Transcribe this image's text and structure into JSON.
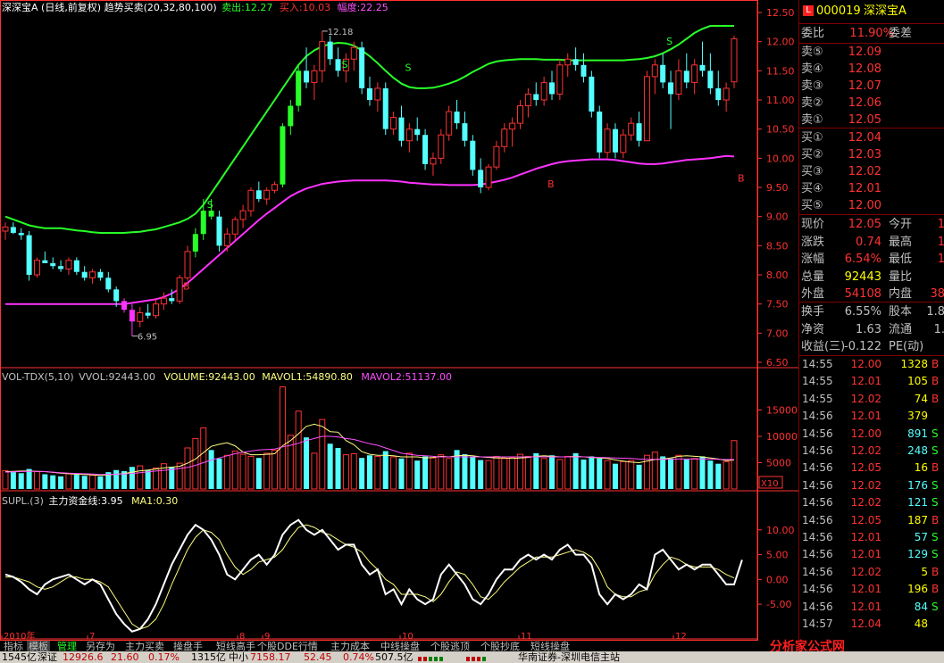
{
  "header": {
    "title": "深深宝A (日线,前复权) 趋势买卖(20,32,80,100)",
    "sell_label": "卖出:12.27",
    "buy_label": "买入:10.03",
    "amp_label": "幅度:22.25"
  },
  "vol_header": {
    "name": "VOL-TDX(5,10)",
    "vvol": "VVOL:92443.00",
    "volume": "VOLUME:92443.00",
    "mavol1": "MAVOL1:54890.80",
    "mavol2": "MAVOL2:51137.00"
  },
  "supl_header": {
    "name": "SUPL.(3)",
    "line": "主力资金线:3.95",
    "ma": "MA1:0.30"
  },
  "annotations": {
    "high": "12.18",
    "low": "6.95",
    "s": "S",
    "b": "B",
    "x10": "X10"
  },
  "axis": {
    "price_ticks": [
      "12.50",
      "12.00",
      "11.50",
      "11.00",
      "10.50",
      "10.00",
      "9.50",
      "9.00",
      "8.50",
      "8.00",
      "7.50",
      "7.00",
      "6.50"
    ],
    "vol_ticks": [
      "15000",
      "10000",
      "5000"
    ],
    "supl_ticks": [
      "10.00",
      "5.00",
      "0.00",
      "-5.00"
    ],
    "months": [
      "2010年",
      "7",
      "8",
      "9",
      "10",
      "11",
      "12"
    ]
  },
  "quote": {
    "code": "000019",
    "name": "深深宝A",
    "weibi_label": "委比",
    "weibi_value": "11.90%",
    "weicha_label": "委差",
    "sell": [
      {
        "label": "卖⑤",
        "price": "12.09"
      },
      {
        "label": "卖④",
        "price": "12.08"
      },
      {
        "label": "卖③",
        "price": "12.07"
      },
      {
        "label": "卖②",
        "price": "12.06"
      },
      {
        "label": "卖①",
        "price": "12.05"
      }
    ],
    "buy": [
      {
        "label": "买①",
        "price": "12.04"
      },
      {
        "label": "买②",
        "price": "12.03"
      },
      {
        "label": "买③",
        "price": "12.02"
      },
      {
        "label": "买④",
        "price": "12.01"
      },
      {
        "label": "买⑤",
        "price": "12.00"
      }
    ],
    "stats": [
      {
        "l1": "现价",
        "v1": "12.05",
        "l2": "今开",
        "v2": "1"
      },
      {
        "l1": "涨跌",
        "v1": "0.74",
        "l2": "最高",
        "v2": "1"
      },
      {
        "l1": "涨幅",
        "v1": "6.54%",
        "l2": "最低",
        "v2": "1"
      },
      {
        "l1": "总量",
        "v1": "92443",
        "l2": "量比",
        "v2": ""
      },
      {
        "l1": "外盘",
        "v1": "54108",
        "l2": "内盘",
        "v2": "38"
      }
    ],
    "stats2": [
      {
        "l1": "换手",
        "v1": "6.55%",
        "l2": "股本",
        "v2": "1.8"
      },
      {
        "l1": "净资",
        "v1": "1.63",
        "l2": "流通",
        "v2": "1."
      },
      {
        "l1": "收益(三)",
        "v1": "-0.122",
        "l2": "PE(动)",
        "v2": ""
      }
    ],
    "ticks": [
      {
        "t": "14:55",
        "p": "12.00",
        "v": "1328",
        "f": "B"
      },
      {
        "t": "14:55",
        "p": "12.01",
        "v": "105",
        "f": "B"
      },
      {
        "t": "14:55",
        "p": "12.02",
        "v": "74",
        "f": "B"
      },
      {
        "t": "14:56",
        "p": "12.01",
        "v": "379",
        "f": ""
      },
      {
        "t": "14:56",
        "p": "12.00",
        "v": "891",
        "f": "S"
      },
      {
        "t": "14:56",
        "p": "12.02",
        "v": "248",
        "f": "S"
      },
      {
        "t": "14:56",
        "p": "12.05",
        "v": "16",
        "f": "B"
      },
      {
        "t": "14:56",
        "p": "12.02",
        "v": "176",
        "f": "S"
      },
      {
        "t": "14:56",
        "p": "12.02",
        "v": "121",
        "f": "S"
      },
      {
        "t": "14:56",
        "p": "12.05",
        "v": "187",
        "f": "B"
      },
      {
        "t": "14:56",
        "p": "12.01",
        "v": "57",
        "f": "S"
      },
      {
        "t": "14:56",
        "p": "12.01",
        "v": "129",
        "v2": "",
        "f": "S"
      },
      {
        "t": "14:56",
        "p": "12.02",
        "v": "5",
        "f": "B"
      },
      {
        "t": "14:56",
        "p": "12.01",
        "v": "196",
        "f": "B"
      },
      {
        "t": "14:56",
        "p": "12.01",
        "v": "84",
        "f": "S"
      },
      {
        "t": "14:57",
        "p": "12.04",
        "v": "48",
        "f": ""
      }
    ]
  },
  "tabs": [
    "指标",
    "模板",
    "管理",
    "另存为",
    "主力买卖",
    "操盘手",
    "短线高手",
    "个股DDE行情",
    "主力成本",
    "中线操盘",
    "个股逃顶",
    "个股抄底",
    "短线操盘"
  ],
  "status": {
    "s1": "1545亿",
    "s2_label": "深证",
    "s2_val": "12926.6",
    "s2_chg": "21.60",
    "s2_pct": "0.17%",
    "s3": "1315亿",
    "s4_label": "中小",
    "s4_val": "7158.17",
    "s4_chg": "52.45",
    "s4_pct": "0.74%",
    "s5": "507.5亿",
    "broker": "华南证券-深圳电信主站"
  },
  "logo_text": "分析家公式网",
  "colors": {
    "up": "#ff3232",
    "down": "#54ffff",
    "upper_band": "#28ff28",
    "lower_band": "#ff32ff",
    "mavol1": "#ffff80",
    "mavol2": "#ff50ff",
    "supl": "#ffffff",
    "supl_ma": "#ffff80",
    "axis": "#ff3232",
    "bg": "#000000"
  },
  "chart_data": {
    "type": "candlestick",
    "price_range": [
      6.5,
      12.5
    ],
    "ohlc": [
      [
        8.75,
        8.9,
        8.6,
        8.82
      ],
      [
        8.82,
        8.9,
        8.7,
        8.72
      ],
      [
        8.72,
        8.8,
        8.6,
        8.68
      ],
      [
        8.68,
        8.75,
        7.9,
        8.0
      ],
      [
        8.0,
        8.3,
        7.95,
        8.25
      ],
      [
        8.25,
        8.4,
        8.2,
        8.2
      ],
      [
        8.2,
        8.3,
        8.1,
        8.15
      ],
      [
        8.15,
        8.25,
        8.05,
        8.1
      ],
      [
        8.1,
        8.3,
        8.0,
        8.25
      ],
      [
        8.25,
        8.3,
        8.0,
        8.05
      ],
      [
        8.05,
        8.15,
        7.9,
        7.95
      ],
      [
        7.95,
        8.1,
        7.85,
        8.05
      ],
      [
        8.05,
        8.1,
        7.9,
        7.95
      ],
      [
        7.95,
        8.05,
        7.7,
        7.75
      ],
      [
        7.75,
        7.8,
        7.45,
        7.55
      ],
      [
        7.55,
        7.6,
        7.35,
        7.4
      ],
      [
        7.4,
        7.5,
        6.95,
        7.2
      ],
      [
        7.2,
        7.45,
        7.1,
        7.35
      ],
      [
        7.35,
        7.5,
        7.25,
        7.3
      ],
      [
        7.3,
        7.6,
        7.25,
        7.5
      ],
      [
        7.5,
        7.7,
        7.4,
        7.6
      ],
      [
        7.6,
        7.75,
        7.5,
        7.55
      ],
      [
        7.55,
        8.0,
        7.5,
        7.95
      ],
      [
        7.95,
        8.5,
        7.9,
        8.4
      ],
      [
        8.4,
        8.8,
        8.3,
        8.7
      ],
      [
        8.7,
        9.3,
        8.6,
        9.1
      ],
      [
        9.1,
        9.3,
        8.95,
        9.0
      ],
      [
        9.0,
        9.1,
        8.4,
        8.5
      ],
      [
        8.5,
        8.8,
        8.4,
        8.7
      ],
      [
        8.7,
        9.0,
        8.6,
        8.95
      ],
      [
        8.95,
        9.2,
        8.8,
        9.1
      ],
      [
        9.1,
        9.5,
        9.0,
        9.45
      ],
      [
        9.45,
        9.6,
        9.25,
        9.3
      ],
      [
        9.3,
        9.5,
        9.2,
        9.45
      ],
      [
        9.45,
        9.6,
        9.4,
        9.55
      ],
      [
        9.55,
        10.6,
        9.5,
        10.55
      ],
      [
        10.55,
        11.0,
        10.4,
        10.9
      ],
      [
        10.9,
        11.6,
        10.8,
        11.5
      ],
      [
        11.5,
        11.9,
        11.2,
        11.3
      ],
      [
        11.3,
        11.6,
        11.0,
        11.5
      ],
      [
        11.5,
        12.18,
        11.3,
        12.0
      ],
      [
        12.0,
        12.1,
        11.6,
        11.7
      ],
      [
        11.7,
        11.9,
        11.4,
        11.5
      ],
      [
        11.5,
        11.8,
        11.3,
        11.7
      ],
      [
        11.7,
        12.0,
        11.5,
        11.9
      ],
      [
        11.9,
        12.0,
        11.1,
        11.2
      ],
      [
        11.2,
        11.4,
        10.9,
        11.0
      ],
      [
        11.0,
        11.3,
        10.8,
        11.2
      ],
      [
        11.2,
        11.3,
        10.4,
        10.5
      ],
      [
        10.5,
        10.8,
        10.4,
        10.7
      ],
      [
        10.7,
        10.9,
        10.2,
        10.3
      ],
      [
        10.3,
        10.6,
        10.1,
        10.5
      ],
      [
        10.5,
        10.7,
        10.3,
        10.4
      ],
      [
        10.4,
        10.5,
        9.8,
        9.9
      ],
      [
        9.9,
        10.1,
        9.7,
        10.0
      ],
      [
        10.0,
        10.5,
        9.9,
        10.4
      ],
      [
        10.4,
        10.9,
        10.3,
        10.8
      ],
      [
        10.8,
        11.0,
        10.5,
        10.6
      ],
      [
        10.6,
        10.8,
        10.2,
        10.3
      ],
      [
        10.3,
        10.4,
        9.7,
        9.8
      ],
      [
        9.8,
        10.0,
        9.4,
        9.5
      ],
      [
        9.5,
        9.9,
        9.45,
        9.85
      ],
      [
        9.85,
        10.3,
        9.8,
        10.2
      ],
      [
        10.2,
        10.6,
        10.1,
        10.5
      ],
      [
        10.5,
        10.7,
        10.2,
        10.6
      ],
      [
        10.6,
        11.0,
        10.5,
        10.9
      ],
      [
        10.9,
        11.2,
        10.7,
        11.1
      ],
      [
        11.1,
        11.3,
        10.9,
        11.0
      ],
      [
        11.0,
        11.4,
        10.9,
        11.3
      ],
      [
        11.3,
        11.5,
        11.0,
        11.1
      ],
      [
        11.1,
        11.7,
        11.0,
        11.6
      ],
      [
        11.6,
        11.8,
        11.4,
        11.7
      ],
      [
        11.7,
        11.9,
        11.5,
        11.6
      ],
      [
        11.6,
        11.8,
        11.3,
        11.4
      ],
      [
        11.4,
        11.5,
        10.7,
        10.8
      ],
      [
        10.8,
        10.9,
        10.0,
        10.1
      ],
      [
        10.1,
        10.6,
        10.0,
        10.5
      ],
      [
        10.5,
        10.6,
        10.0,
        10.1
      ],
      [
        10.1,
        10.5,
        10.0,
        10.4
      ],
      [
        10.4,
        10.7,
        10.3,
        10.6
      ],
      [
        10.6,
        10.8,
        10.2,
        10.3
      ],
      [
        10.3,
        11.5,
        10.3,
        11.4
      ],
      [
        11.4,
        11.7,
        11.1,
        11.6
      ],
      [
        11.6,
        11.8,
        11.2,
        11.3
      ],
      [
        11.3,
        11.5,
        10.5,
        11.1
      ],
      [
        11.1,
        11.7,
        11.0,
        11.5
      ],
      [
        11.5,
        11.8,
        11.2,
        11.3
      ],
      [
        11.3,
        11.7,
        11.1,
        11.6
      ],
      [
        11.6,
        12.0,
        11.4,
        11.5
      ],
      [
        11.5,
        11.8,
        11.1,
        11.2
      ],
      [
        11.2,
        11.5,
        10.9,
        11.0
      ],
      [
        11.0,
        11.3,
        10.8,
        11.2
      ],
      [
        11.31,
        12.1,
        11.2,
        12.05
      ]
    ],
    "upper_band": [
      9.0,
      8.95,
      8.9,
      8.85,
      8.82,
      8.8,
      8.8,
      8.8,
      8.78,
      8.76,
      8.75,
      8.73,
      8.72,
      8.72,
      8.72,
      8.72,
      8.73,
      8.74,
      8.76,
      8.78,
      8.82,
      8.86,
      8.9,
      8.96,
      9.05,
      9.2,
      9.4,
      9.6,
      9.8,
      10.0,
      10.2,
      10.4,
      10.6,
      10.8,
      11.0,
      11.2,
      11.4,
      11.6,
      11.75,
      11.85,
      11.92,
      11.96,
      11.98,
      11.97,
      11.93,
      11.85,
      11.75,
      11.63,
      11.5,
      11.38,
      11.28,
      11.22,
      11.2,
      11.2,
      11.21,
      11.24,
      11.28,
      11.33,
      11.4,
      11.48,
      11.55,
      11.62,
      11.66,
      11.68,
      11.69,
      11.7,
      11.7,
      11.7,
      11.69,
      11.69,
      11.69,
      11.68,
      11.68,
      11.68,
      11.68,
      11.68,
      11.68,
      11.68,
      11.68,
      11.69,
      11.7,
      11.72,
      11.75,
      11.8,
      11.87,
      11.95,
      12.05,
      12.15,
      12.22,
      12.27,
      12.27,
      12.27,
      12.27
    ],
    "lower_band": [
      7.5,
      7.5,
      7.5,
      7.5,
      7.5,
      7.5,
      7.5,
      7.5,
      7.5,
      7.5,
      7.5,
      7.5,
      7.5,
      7.5,
      7.5,
      7.5,
      7.52,
      7.54,
      7.56,
      7.58,
      7.62,
      7.68,
      7.76,
      7.86,
      7.98,
      8.1,
      8.22,
      8.34,
      8.46,
      8.58,
      8.7,
      8.82,
      8.94,
      9.05,
      9.15,
      9.25,
      9.35,
      9.42,
      9.48,
      9.52,
      9.56,
      9.58,
      9.6,
      9.61,
      9.62,
      9.62,
      9.62,
      9.62,
      9.62,
      9.61,
      9.6,
      9.58,
      9.57,
      9.56,
      9.55,
      9.55,
      9.54,
      9.54,
      9.54,
      9.54,
      9.55,
      9.57,
      9.6,
      9.63,
      9.67,
      9.72,
      9.77,
      9.82,
      9.86,
      9.9,
      9.93,
      9.95,
      9.96,
      9.97,
      9.98,
      9.98,
      9.98,
      9.97,
      9.95,
      9.93,
      9.91,
      9.9,
      9.9,
      9.91,
      9.93,
      9.95,
      9.97,
      9.98,
      9.99,
      10.0,
      10.02,
      10.04,
      10.03
    ],
    "volume": [
      3500,
      3200,
      3000,
      3800,
      3300,
      2800,
      2600,
      2400,
      2900,
      2700,
      2500,
      2600,
      2400,
      3200,
      3600,
      3400,
      4200,
      4400,
      3600,
      4000,
      4800,
      4200,
      4900,
      7800,
      9600,
      11600,
      7400,
      5800,
      6400,
      7200,
      6600,
      6200,
      5900,
      6800,
      7400,
      19400,
      10200,
      14800,
      9800,
      6800,
      13200,
      8600,
      7800,
      6500,
      6700,
      5900,
      6400,
      6200,
      7200,
      6100,
      5800,
      6800,
      5400,
      6200,
      5900,
      6500,
      5800,
      7400,
      6600,
      6200,
      5500,
      5400,
      6200,
      5800,
      6000,
      6600,
      6200,
      6800,
      5800,
      6400,
      5600,
      6200,
      6800,
      5600,
      6200,
      5800,
      5400,
      4800,
      5200,
      5400,
      4600,
      6400,
      7000,
      6200,
      5800,
      6400,
      5600,
      5800,
      6200,
      5400,
      4800,
      5200,
      9200
    ],
    "mavol1": [
      3300,
      3350,
      3400,
      3400,
      3350,
      3300,
      3150,
      3000,
      2900,
      2800,
      2750,
      2700,
      2600,
      2700,
      2800,
      2950,
      3200,
      3450,
      3600,
      3800,
      4000,
      4150,
      4300,
      4900,
      5700,
      6900,
      8100,
      8500,
      8800,
      8200,
      7000,
      6500,
      6500,
      6600,
      6700,
      8200,
      9200,
      10500,
      11900,
      12300,
      11900,
      10900,
      10800,
      9200,
      8400,
      7100,
      6600,
      6400,
      6400,
      6300,
      6100,
      6100,
      6100,
      5900,
      6000,
      6200,
      6100,
      6300,
      6400,
      6300,
      6100,
      6000,
      5900,
      5900,
      5800,
      5900,
      6000,
      6200,
      6300,
      6200,
      6100,
      6100,
      6200,
      6100,
      6000,
      5900,
      5800,
      5500,
      5300,
      5100,
      5000,
      5300,
      5600,
      5700,
      5900,
      6200,
      6300,
      6200,
      6100,
      5900,
      5700,
      5400,
      5500
    ],
    "mavol2": [
      3200,
      3250,
      3300,
      3350,
      3360,
      3300,
      3200,
      3100,
      3000,
      2950,
      2900,
      2850,
      2750,
      2780,
      2820,
      2860,
      2950,
      3100,
      3250,
      3400,
      3550,
      3700,
      3900,
      4100,
      4500,
      5000,
      5500,
      5900,
      6300,
      6700,
      7000,
      7200,
      7400,
      7500,
      7600,
      8000,
      8300,
      8700,
      9200,
      9600,
      10000,
      10000,
      9900,
      9600,
      9400,
      9000,
      8600,
      8300,
      7800,
      7300,
      6800,
      6600,
      6400,
      6300,
      6200,
      6100,
      6100,
      6100,
      6100,
      6100,
      6100,
      6100,
      6100,
      6100,
      6100,
      6100,
      6100,
      6100,
      6100,
      6100,
      6100,
      6100,
      6100,
      6100,
      6050,
      6000,
      5950,
      5900,
      5850,
      5800,
      5700,
      5650,
      5650,
      5650,
      5650,
      5700,
      5700,
      5700,
      5700,
      5700,
      5650,
      5600,
      5600
    ],
    "supl": [
      1,
      0.5,
      -0.5,
      -2,
      -3,
      -1,
      0,
      0.5,
      1,
      0,
      -1,
      0,
      -1,
      -4,
      -7,
      -9,
      -10.5,
      -10,
      -8,
      -5,
      -1,
      3,
      6,
      9,
      11,
      10,
      8,
      5,
      1,
      0,
      2,
      4,
      5,
      3,
      5,
      9,
      11,
      12,
      10,
      9,
      10,
      8,
      6,
      7,
      7,
      3,
      1,
      2,
      -3,
      -2,
      -5,
      -2,
      -4,
      -5,
      -4,
      1,
      3,
      1,
      -1,
      -4,
      -5,
      -3,
      0,
      2,
      2,
      4,
      5,
      4,
      5,
      4,
      6,
      7,
      5,
      5,
      3,
      -3,
      -5,
      -3,
      -4,
      -3,
      -1,
      -2,
      5,
      6,
      4,
      2,
      3,
      2,
      3,
      3,
      1,
      -1,
      -1,
      3.95
    ],
    "supl_ma": [
      0.5,
      0.5,
      0,
      -0.5,
      -1.5,
      -2,
      -1.5,
      -0.5,
      0.5,
      0.5,
      0,
      0,
      -0.5,
      -1.5,
      -4,
      -6.5,
      -9,
      -10,
      -9.5,
      -8,
      -5,
      -1,
      2.5,
      6,
      8.5,
      10,
      9.5,
      8,
      5,
      2.5,
      1,
      2,
      3.5,
      4,
      4.5,
      6,
      8.5,
      10.5,
      11,
      10.5,
      9.5,
      9,
      8,
      7,
      6.5,
      5.5,
      3.5,
      2,
      0,
      -1,
      -3,
      -3,
      -3,
      -3.5,
      -4.5,
      -3,
      -0.5,
      1.5,
      1,
      -1,
      -3.5,
      -4,
      -2.5,
      -0.5,
      1,
      2.5,
      3.5,
      4.5,
      4.5,
      4.5,
      5,
      5.5,
      6,
      5.5,
      4.5,
      2,
      -1.5,
      -3,
      -3.5,
      -3.5,
      -2.5,
      -2,
      1,
      3,
      4.5,
      4,
      3,
      2.5,
      2.5,
      2.5,
      2,
      1,
      0.3
    ],
    "supl_range": [
      -12,
      15
    ],
    "vol_range": [
      0,
      20000
    ]
  }
}
